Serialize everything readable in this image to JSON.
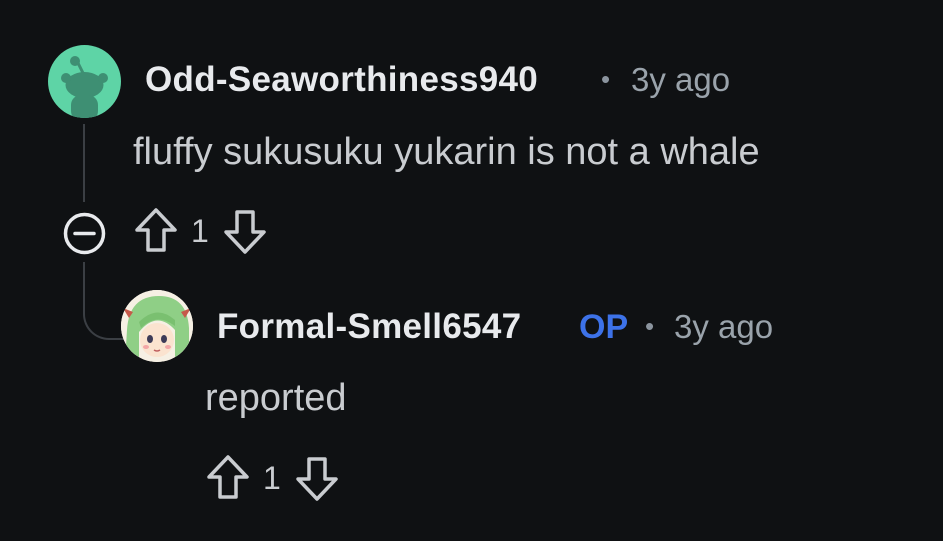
{
  "comments": [
    {
      "username": "Odd-Seaworthiness940",
      "separator": "•",
      "time": "3y ago",
      "body": "fluffy sukusuku yukarin is not a whale",
      "score": "1",
      "avatar": "reddit-snoo-avatar"
    },
    {
      "username": "Formal-Smell6547",
      "op_badge": "OP",
      "separator": "•",
      "time": "3y ago",
      "body": "reported",
      "score": "1",
      "avatar": "anime-character-avatar"
    }
  ],
  "colors": {
    "background": "#0f1113",
    "op_badge": "#3d72e8",
    "avatar_mint": "#5ed4a6"
  }
}
